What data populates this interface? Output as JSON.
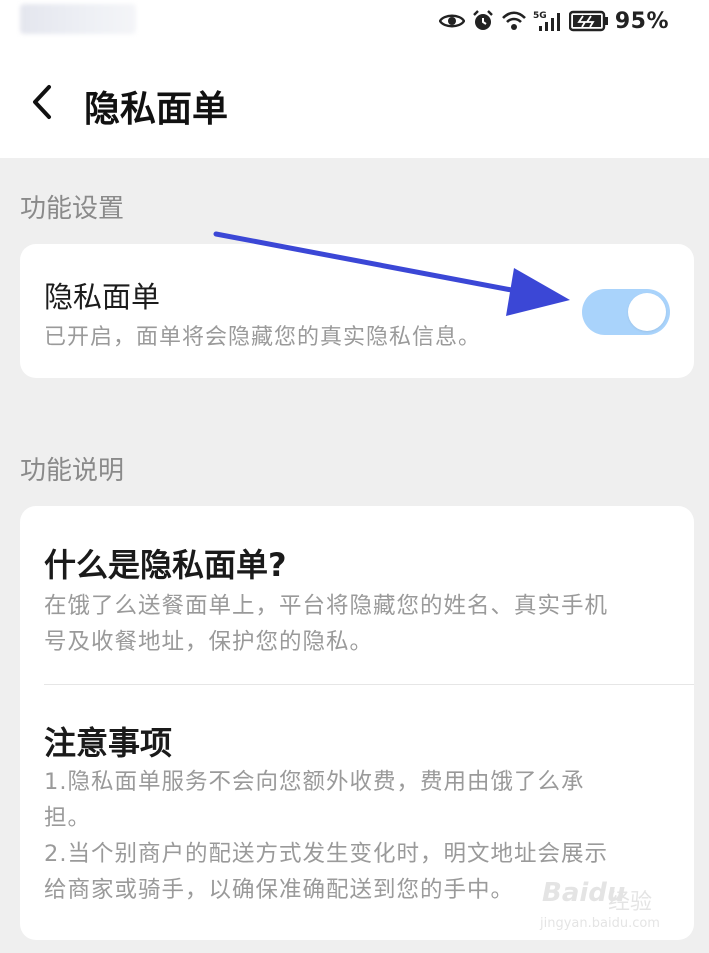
{
  "status_bar": {
    "battery_percent": "95%",
    "icons": [
      "eye-icon",
      "alarm-icon",
      "wifi-icon",
      "signal-5g-icon",
      "battery-icon"
    ],
    "network_label": "5G"
  },
  "header": {
    "back_icon": "chevron-left-icon",
    "title": "隐私面单"
  },
  "sections": {
    "settings_label": "功能设置",
    "explain_label": "功能说明"
  },
  "privacy_setting": {
    "title": "隐私面单",
    "subtitle": "已开启，面单将会隐藏您的真实隐私信息。",
    "toggle_on": true,
    "toggle_color": "#a9d3fb"
  },
  "explanation": {
    "q1_title": "什么是隐私面单?",
    "q1_body_line1": "在饿了么送餐面单上，平台将隐藏您的姓名、真实手机",
    "q1_body_line2": "号及收餐地址，保护您的隐私。",
    "q2_title": "注意事项",
    "q2_body_line1": "1.隐私面单服务不会向您额外收费，费用由饿了么承",
    "q2_body_line2": "担。",
    "q2_body_line3": "2.当个别商户的配送方式发生变化时，明文地址会展示",
    "q2_body_line4": "给商家或骑手，以确保准确配送到您的手中。"
  },
  "annotation": {
    "arrow_color": "#3b47d6"
  },
  "watermark": {
    "brand": "Baidu",
    "sub": "经验",
    "url": "jingyan.baidu.com"
  },
  "colors": {
    "page_bg": "#efefef",
    "card_bg": "#ffffff",
    "muted_text": "#9a9a9a"
  }
}
